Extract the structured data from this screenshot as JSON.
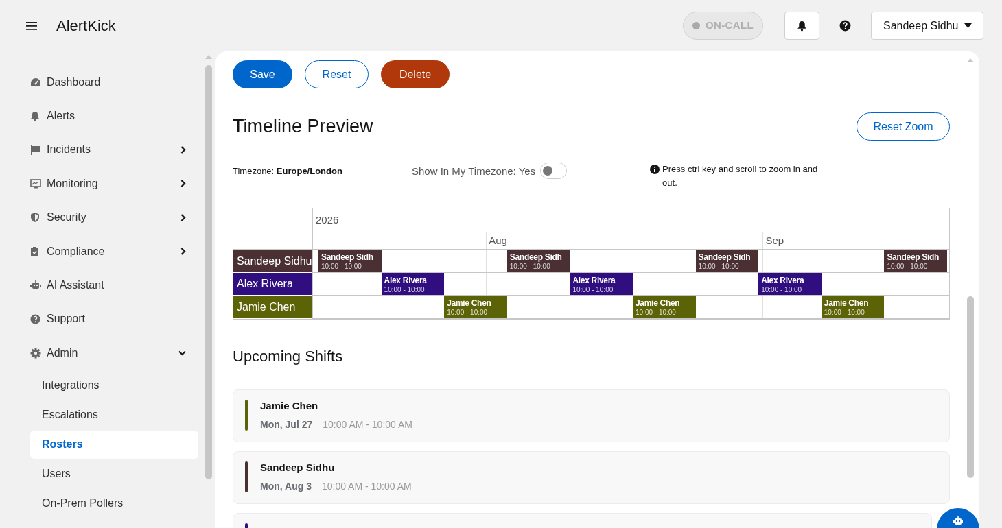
{
  "app": {
    "title": "AlertKick"
  },
  "header": {
    "oncall": {
      "label": "ON-CALL",
      "active": false
    },
    "user": "Sandeep Sidhu"
  },
  "sidebar": {
    "items": [
      {
        "label": "Dashboard",
        "selected": false
      },
      {
        "label": "Alerts",
        "selected": false
      },
      {
        "label": "Incidents",
        "expanded": false,
        "selected": false
      },
      {
        "label": "Monitoring",
        "expanded": false,
        "selected": false
      },
      {
        "label": "Security",
        "expanded": false,
        "selected": false
      },
      {
        "label": "Compliance",
        "expanded": false,
        "selected": false
      },
      {
        "label": "AI Assistant",
        "selected": false
      },
      {
        "label": "Support",
        "selected": false
      },
      {
        "label": "Admin",
        "expanded": true,
        "selected": false,
        "children": [
          {
            "label": "Integrations",
            "selected": false
          },
          {
            "label": "Escalations",
            "selected": false
          },
          {
            "label": "Rosters",
            "selected": true
          },
          {
            "label": "Users",
            "selected": false
          },
          {
            "label": "On-Prem Pollers",
            "selected": false
          }
        ]
      }
    ]
  },
  "actions": [
    {
      "label": "Save",
      "kind": "primary"
    },
    {
      "label": "Reset",
      "kind": "secondary"
    },
    {
      "label": "Delete",
      "kind": "danger"
    }
  ],
  "timeline": {
    "title": "Timeline Preview",
    "reset_zoom": "Reset Zoom",
    "timezone_label": "Timezone:",
    "timezone": "Europe/London",
    "show_in_my_timezone": {
      "label": "Show In My Timezone: Yes",
      "on": false
    },
    "hint": "Press ctrl key and scroll to zoom in and out.",
    "year": "2026",
    "months": [
      {
        "label": "Aug"
      },
      {
        "label": "Sep"
      }
    ],
    "lanes": [
      {
        "name": "Sandeep Sidhu",
        "color": "#4a2f33",
        "cells": [
          {
            "kind": "shift",
            "name": "Sandeep Sidh",
            "time": "10:00 - 10:00"
          },
          {
            "kind": "empty"
          },
          {
            "kind": "empty"
          },
          {
            "kind": "shift",
            "name": "Sandeep Sidh",
            "time": "10:00 - 10:00"
          },
          {
            "kind": "empty"
          },
          {
            "kind": "empty"
          },
          {
            "kind": "shift",
            "name": "Sandeep Sidh",
            "time": "10:00 - 10:00"
          },
          {
            "kind": "empty"
          },
          {
            "kind": "empty"
          },
          {
            "kind": "shift",
            "name": "Sandeep Sidh",
            "time": "10:00 - 10:00"
          }
        ]
      },
      {
        "name": "Alex Rivera",
        "color": "#300e80",
        "cells": [
          {
            "kind": "empty"
          },
          {
            "kind": "shift",
            "name": "Alex Rivera",
            "time": "10:00 - 10:00"
          },
          {
            "kind": "empty"
          },
          {
            "kind": "empty"
          },
          {
            "kind": "shift",
            "name": "Alex Rivera",
            "time": "10:00 - 10:00"
          },
          {
            "kind": "empty"
          },
          {
            "kind": "empty"
          },
          {
            "kind": "shift",
            "name": "Alex Rivera",
            "time": "10:00 - 10:00"
          },
          {
            "kind": "empty"
          },
          {
            "kind": "empty"
          }
        ]
      },
      {
        "name": "Jamie Chen",
        "color": "#5c6206",
        "cells": [
          {
            "kind": "empty"
          },
          {
            "kind": "empty"
          },
          {
            "kind": "shift",
            "name": "Jamie Chen",
            "time": "10:00 - 10:00"
          },
          {
            "kind": "empty"
          },
          {
            "kind": "empty"
          },
          {
            "kind": "shift",
            "name": "Jamie Chen",
            "time": "10:00 - 10:00"
          },
          {
            "kind": "empty"
          },
          {
            "kind": "empty"
          },
          {
            "kind": "shift",
            "name": "Jamie Chen",
            "time": "10:00 - 10:00"
          },
          {
            "kind": "empty"
          }
        ]
      }
    ]
  },
  "upcoming": {
    "title": "Upcoming Shifts",
    "shifts": [
      {
        "name": "Jamie Chen",
        "date": "Mon, Jul 27",
        "time": "10:00 AM - 10:00 AM",
        "color": "#5c6206"
      },
      {
        "name": "Sandeep Sidhu",
        "date": "Mon, Aug 3",
        "time": "10:00 AM - 10:00 AM",
        "color": "#4a2f33"
      },
      {
        "color": "#300e80"
      }
    ]
  }
}
